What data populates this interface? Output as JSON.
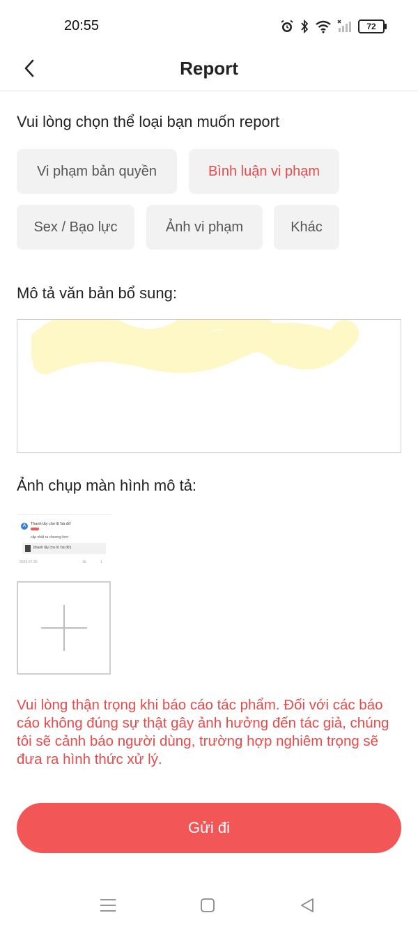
{
  "status_bar": {
    "time": "20:55",
    "battery": "72",
    "icons": [
      "alarm-icon",
      "bluetooth-icon",
      "wifi-icon",
      "signal-icon",
      "battery-icon"
    ]
  },
  "header": {
    "title": "Report",
    "back_icon": "chevron-left-icon"
  },
  "category": {
    "prompt": "Vui lòng chọn thể loại bạn muốn report",
    "options": [
      {
        "label": "Vi phạm bản quyền",
        "selected": false
      },
      {
        "label": "Bình luận vi phạm",
        "selected": true
      },
      {
        "label": "Sex / Bạo lực",
        "selected": false
      },
      {
        "label": "Ảnh vi phạm",
        "selected": false
      },
      {
        "label": "Khác",
        "selected": false
      }
    ]
  },
  "description": {
    "label": "Mô tả văn bản bổ sung:",
    "value": ""
  },
  "screenshot": {
    "label": "Ảnh chụp màn hình mô tả:",
    "thumbnail": {
      "avatar_letter": "A",
      "line1": "Thanh tẩy cho lũ 'bà đồ'",
      "line2": "cập nhật ra chương hơn",
      "line3": "[thanh tẩy cho lũ 'bà đồ']",
      "date": "2023-07-20",
      "comments": "16",
      "likes": "1"
    },
    "add_icon": "plus-icon"
  },
  "warning": "Vui lòng thận trọng khi báo cáo tác phẩm. Đối với các báo cáo không đúng sự thật gây ảnh hưởng đến tác giả, chúng tôi sẽ cảnh báo người dùng, trường hợp nghiêm trọng sẽ đưa ra hình thức xử lý.",
  "submit": {
    "label": "Gửi đi"
  },
  "colors": {
    "accent": "#f25656",
    "selected_text": "#e84a4a",
    "chip_bg": "#f2f2f2"
  },
  "system_nav": [
    "menu-icon",
    "home-icon",
    "back-triangle-icon"
  ]
}
